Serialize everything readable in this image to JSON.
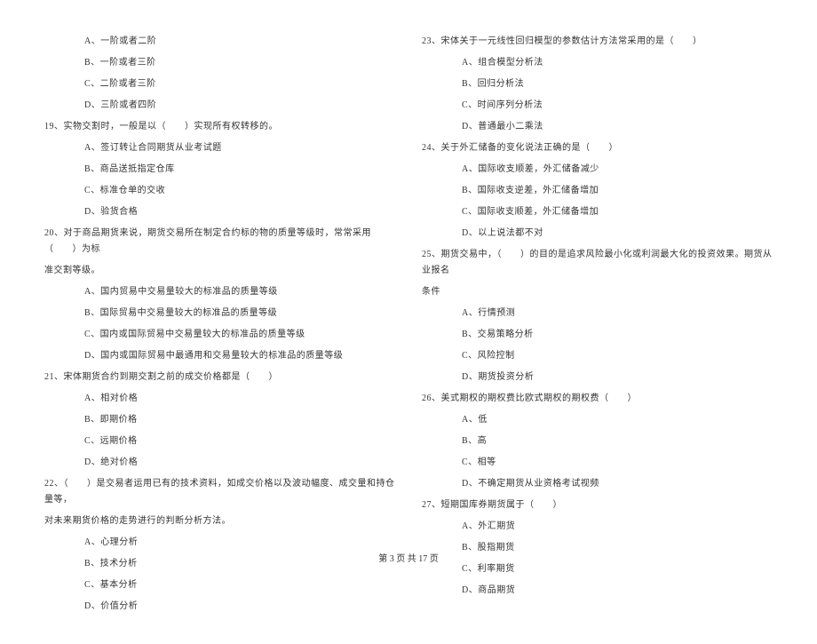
{
  "left_column": {
    "q18_options": {
      "a": "A、一阶或者二阶",
      "b": "B、一阶或者三阶",
      "c": "C、二阶或者三阶",
      "d": "D、三阶或者四阶"
    },
    "q19": {
      "text": "19、实物交割时，一般是以（　　）实现所有权转移的。",
      "options": {
        "a": "A、签订转让合同期货从业考试题",
        "b": "B、商品送抵指定仓库",
        "c": "C、标准仓单的交收",
        "d": "D、验货合格"
      }
    },
    "q20": {
      "text": "20、对于商品期货来说，期货交易所在制定合约标的物的质量等级时，常常采用（　　）为标",
      "cont": "准交割等级。",
      "options": {
        "a": "A、国内贸易中交易量较大的标准品的质量等级",
        "b": "B、国际贸易中交易量较大的标准品的质量等级",
        "c": "C、国内或国际贸易中交易量较大的标准品的质量等级",
        "d": "D、国内或国际贸易中最通用和交易量较大的标准品的质量等级"
      }
    },
    "q21": {
      "text": "21、宋体期货合约到期交割之前的成交价格都是（　　）",
      "options": {
        "a": "A、相对价格",
        "b": "B、即期价格",
        "c": "C、远期价格",
        "d": "D、绝对价格"
      }
    },
    "q22": {
      "text": "22、（　　）是交易者运用已有的技术资料，如成交价格以及波动幅度、成交量和持仓量等，",
      "cont": "对未来期货价格的走势进行的判断分析方法。",
      "options": {
        "a": "A、心理分析",
        "b": "B、技术分析",
        "c": "C、基本分析",
        "d": "D、价值分析"
      }
    }
  },
  "right_column": {
    "q23": {
      "text": "23、宋体关于一元线性回归模型的参数估计方法常采用的是（　　）",
      "options": {
        "a": "A、组合模型分析法",
        "b": "B、回归分析法",
        "c": "C、时间序列分析法",
        "d": "D、普通最小二乘法"
      }
    },
    "q24": {
      "text": "24、关于外汇储备的变化说法正确的是（　　）",
      "options": {
        "a": "A、国际收支顺差，外汇储备减少",
        "b": "B、国际收支逆差，外汇储备增加",
        "c": "C、国际收支顺差，外汇储备增加",
        "d": "D、以上说法都不对"
      }
    },
    "q25": {
      "text": "25、期货交易中，（　　）的目的是追求风险最小化或利润最大化的投资效果。期货从业报名",
      "cont": "条件",
      "options": {
        "a": "A、行情预测",
        "b": "B、交易策略分析",
        "c": "C、风险控制",
        "d": "D、期货投资分析"
      }
    },
    "q26": {
      "text": "26、美式期权的期权费比欧式期权的期权费（　　）",
      "options": {
        "a": "A、低",
        "b": "B、高",
        "c": "C、相等",
        "d": "D、不确定期货从业资格考试视频"
      }
    },
    "q27": {
      "text": "27、短期国库券期货属于（　　）",
      "options": {
        "a": "A、外汇期货",
        "b": "B、股指期货",
        "c": "C、利率期货",
        "d": "D、商品期货"
      }
    }
  },
  "footer": "第 3 页 共 17 页"
}
